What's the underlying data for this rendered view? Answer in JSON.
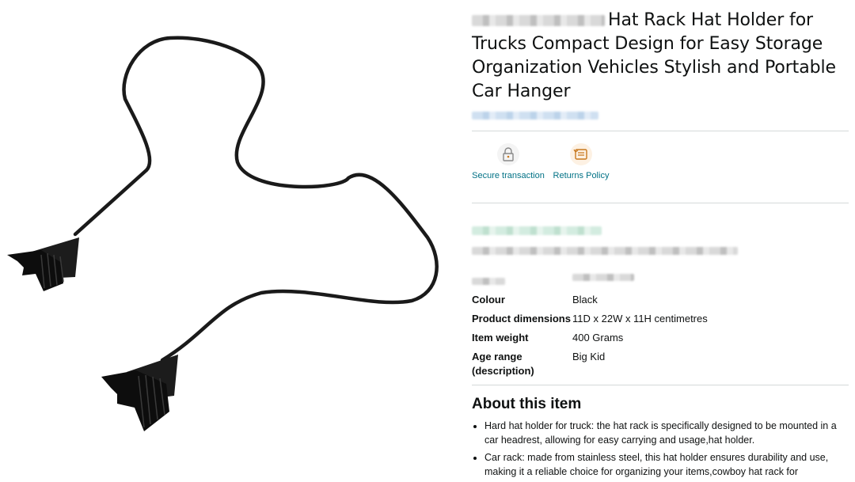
{
  "product": {
    "title": "Hat Rack Hat Holder for Trucks Compact Design for Easy Storage Organization Vehicles Stylish and Portable Car Hanger",
    "image_alt": "Black wire hat rack with two headrest clips"
  },
  "badges": [
    {
      "icon": "lock-icon",
      "label": "Secure transaction"
    },
    {
      "icon": "returns-icon",
      "label": "Returns Policy"
    }
  ],
  "specs": [
    {
      "key": "Colour",
      "value": "Black"
    },
    {
      "key": "Product dimensions",
      "value": "11D x 22W x 11H centimetres"
    },
    {
      "key": "Item weight",
      "value": "400 Grams"
    },
    {
      "key": "Age range (description)",
      "value": "Big Kid"
    }
  ],
  "about": {
    "heading": "About this item",
    "bullets": [
      "Hard hat holder for truck: the hat rack is specifically designed to be mounted in a car headrest, allowing for easy carrying and usage,hat holder.",
      "Car rack: made from stainless steel, this hat holder ensures durability and use, making it a reliable choice for organizing your items,cowboy hat rack for"
    ]
  },
  "colors": {
    "link": "#007185",
    "text": "#0f1111",
    "divider": "#d5d9d9"
  }
}
